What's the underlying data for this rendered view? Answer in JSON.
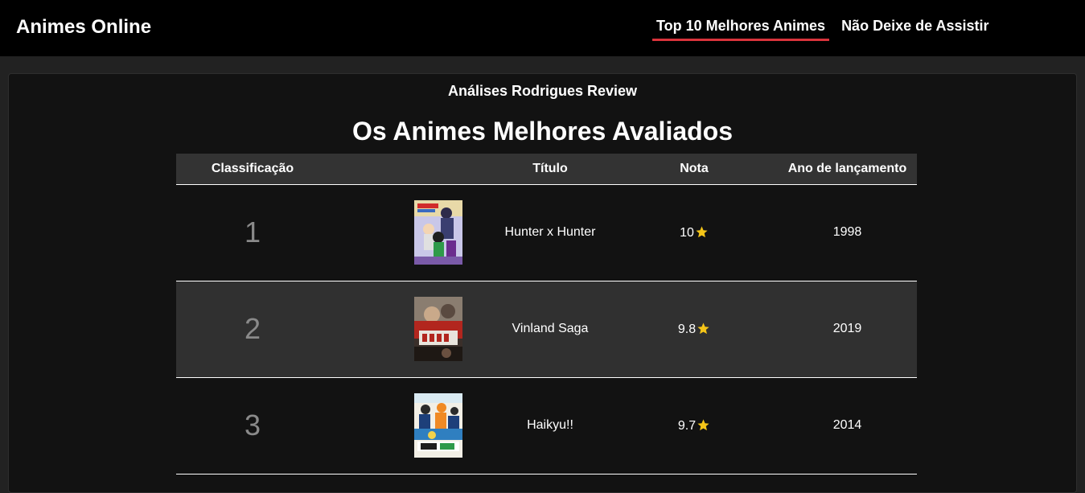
{
  "header": {
    "brand": "Animes Online",
    "nav": [
      {
        "label": "Top 10 Melhores Animes",
        "active": true
      },
      {
        "label": "Não Deixe de Assistir",
        "active": false
      }
    ]
  },
  "main": {
    "subtitle": "Análises Rodrigues Review",
    "title": "Os Animes Melhores Avaliados",
    "table": {
      "columns": [
        "Classificação",
        "",
        "Título",
        "Nota",
        "Ano de lançamento"
      ],
      "rows": [
        {
          "rank": "1",
          "title": "Hunter x Hunter",
          "score": "10",
          "year": "1998",
          "cover_icon": "hunter-x-hunter-poster"
        },
        {
          "rank": "2",
          "title": "Vinland Saga",
          "score": "9.8",
          "year": "2019",
          "cover_icon": "vinland-saga-poster"
        },
        {
          "rank": "3",
          "title": "Haikyu!!",
          "score": "9.7",
          "year": "2014",
          "cover_icon": "haikyuu-poster"
        }
      ]
    }
  },
  "colors": {
    "topbar": "#000000",
    "active_underline": "#d9333b",
    "star": "#f5c518",
    "row_alt": "#303030"
  }
}
